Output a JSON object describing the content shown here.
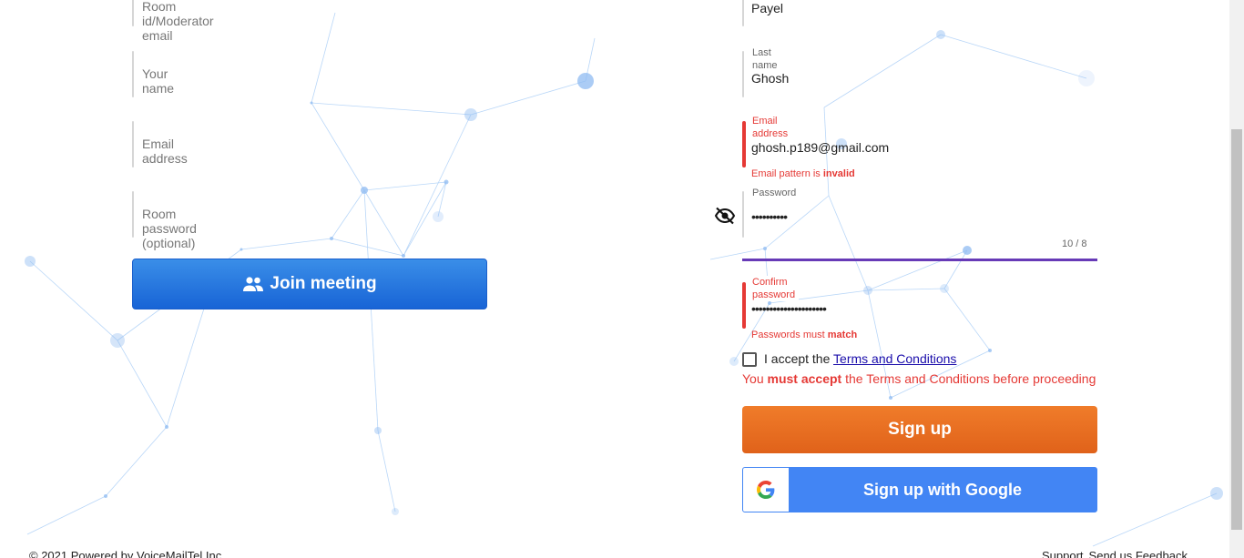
{
  "join": {
    "room_placeholder": "Room id/Moderator email",
    "name_placeholder": "Your name",
    "email_placeholder": "Email address",
    "password_placeholder": "Room password (optional)",
    "join_button": "Join meeting"
  },
  "signup": {
    "first_name_value": "Payel",
    "last_name_label": "Last name",
    "last_name_value": "Ghosh",
    "email_label": "Email address",
    "email_value": "ghosh.p189@gmail.com",
    "email_error_prefix": "Email pattern is",
    "email_error_strong": "invalid",
    "password_label": "Password",
    "password_value": "••••••••••",
    "password_counter": "10 / 8",
    "confirm_label": "Confirm password",
    "confirm_value": "•••••••••••••••••••••",
    "confirm_error_prefix": "Passwords must",
    "confirm_error_strong": "match",
    "accept_prefix": "I accept the",
    "terms_link": "Terms and Conditions",
    "terms_error_pre": "You",
    "terms_error_strong": "must accept",
    "terms_error_post": "the Terms and Conditions before proceeding",
    "signup_button": "Sign up",
    "google_button": "Sign up with Google"
  },
  "footer": {
    "copyright": "© 2021 Powered by VoiceMailTel Inc.",
    "support": "Support",
    "feedback": "Send us Feedback"
  },
  "colors": {
    "join_button": "#1f6fdc",
    "signup_button": "#e8681f",
    "google_button": "#4285f4",
    "error": "#e53935",
    "strength_bar": "#673ab7"
  },
  "icons": {
    "join": "people-icon",
    "password_toggle": "eye-off-icon",
    "google": "google-logo-icon"
  }
}
